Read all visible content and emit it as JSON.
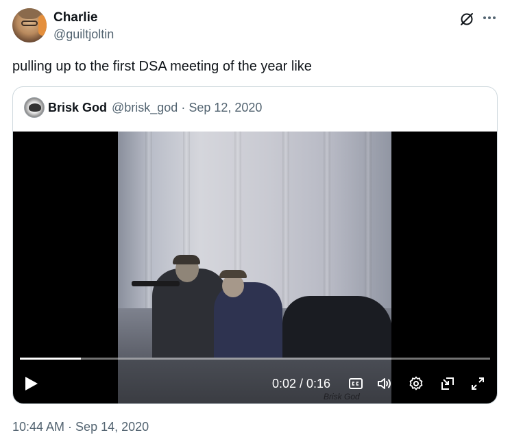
{
  "author": {
    "display_name": "Charlie",
    "handle": "@guiltjoltin"
  },
  "tweet": {
    "text": "pulling up to the first DSA meeting of the year like",
    "timestamp": "10:44 AM · Sep 14, 2020"
  },
  "quoted": {
    "display_name": "Brisk God",
    "meta": "@brisk_god · Sep 12, 2020",
    "video": {
      "time": "0:02 / 0:16",
      "progress": 0.13,
      "watermark": "Brisk God"
    }
  },
  "icons": {
    "header": [
      "grok-icon",
      "more-icon"
    ],
    "controls": [
      "play-icon",
      "captions-icon",
      "volume-icon",
      "settings-icon",
      "pip-icon",
      "fullscreen-icon"
    ]
  },
  "colors": {
    "text": "#0f1419",
    "secondary": "#536471",
    "border": "#cfd9de",
    "video_bg": "#000000"
  }
}
